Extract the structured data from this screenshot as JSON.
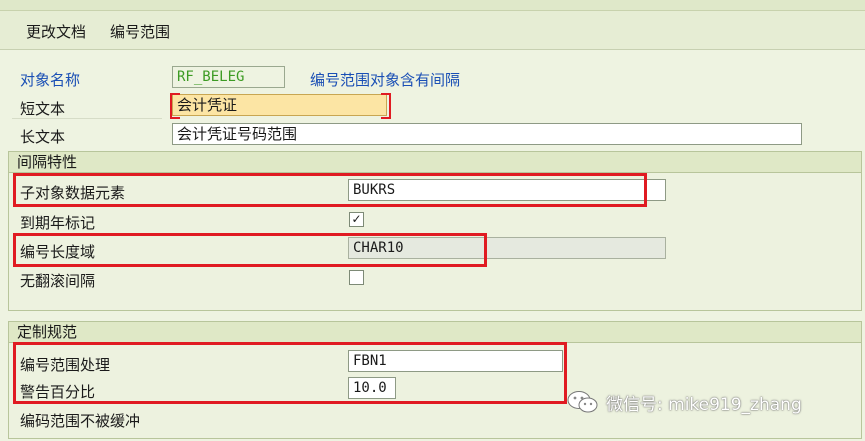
{
  "menu": {
    "change_doc": "更改文档",
    "number_range": "编号范围"
  },
  "header": {
    "object_name_label": "对象名称",
    "object_name_value": "RF_BELEG",
    "object_note": "编号范围对象含有间隔",
    "short_text_label": "短文本",
    "short_text_value": "会计凭证",
    "long_text_label": "长文本",
    "long_text_value": "会计凭证号码范围"
  },
  "interval": {
    "title": "间隔特性",
    "subobject_label": "子对象数据元素",
    "subobject_value": "BUKRS",
    "fiscal_year_label": "到期年标记",
    "fiscal_year_checked": true,
    "length_domain_label": "编号长度域",
    "length_domain_value": "CHAR10",
    "no_rollover_label": "无翻滚间隔",
    "no_rollover_checked": false
  },
  "custom": {
    "title": "定制规范",
    "number_range_tx_label": "编号范围处理",
    "number_range_tx_value": "FBN1",
    "warning_pct_label": "警告百分比",
    "warning_pct_value": "10.0",
    "no_buffer_label": "编码范围不被缓冲"
  },
  "watermark": {
    "text": "微信号: mike919_zhang",
    "icon": "wechat-icon"
  },
  "colors": {
    "highlight": "#e01b22",
    "link_blue": "#1a4fb5",
    "green_text": "#3c9b23"
  }
}
